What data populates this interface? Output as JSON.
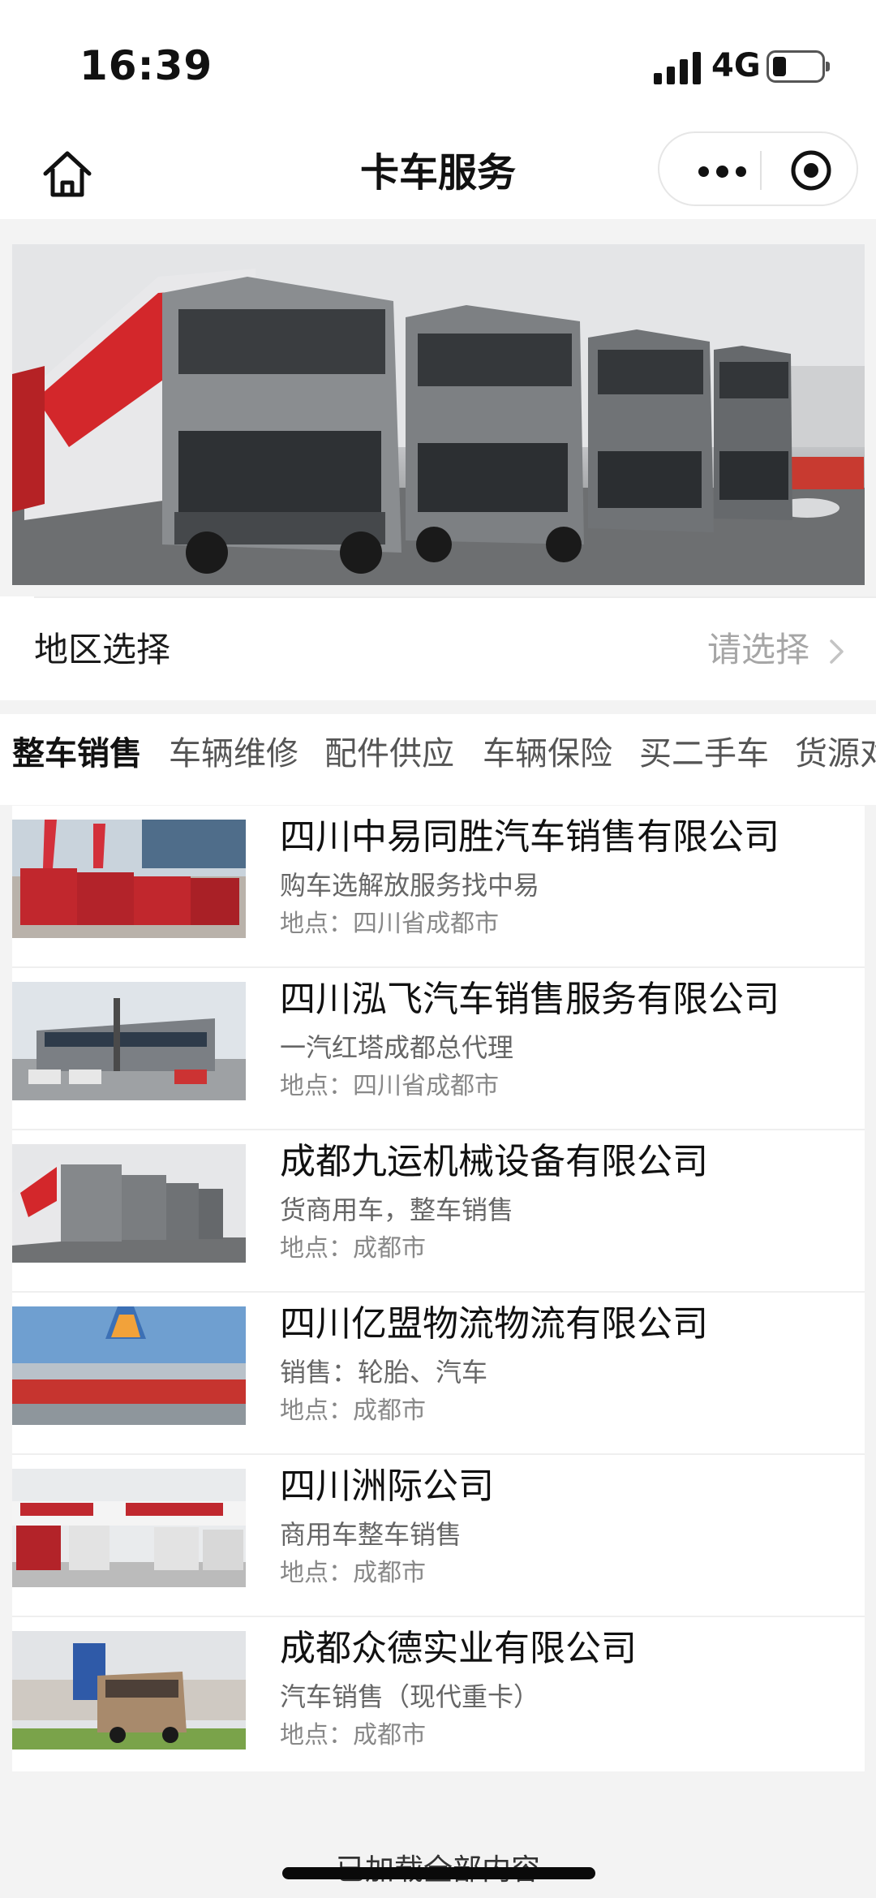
{
  "status_bar": {
    "time": "16:39",
    "network": "4G"
  },
  "nav": {
    "title": "卡车服务"
  },
  "region": {
    "label": "地区选择",
    "placeholder": "请选择"
  },
  "tabs": [
    {
      "label": "整车销售",
      "active": true
    },
    {
      "label": "车辆维修",
      "active": false
    },
    {
      "label": "配件供应",
      "active": false
    },
    {
      "label": "车辆保险",
      "active": false
    },
    {
      "label": "买二手车",
      "active": false
    },
    {
      "label": "货源对",
      "active": false
    }
  ],
  "companies": [
    {
      "name": "四川中易同胜汽车销售有限公司",
      "desc": "购车选解放服务找中易",
      "location": "地点：四川省成都市"
    },
    {
      "name": "四川泓飞汽车销售服务有限公司",
      "desc": "一汽红塔成都总代理",
      "location": "地点：四川省成都市"
    },
    {
      "name": "成都九运机械设备有限公司",
      "desc": "货商用车，整车销售",
      "location": "地点：成都市"
    },
    {
      "name": "四川亿盟物流物流有限公司",
      "desc": "销售：轮胎、汽车",
      "location": "地点：成都市"
    },
    {
      "name": "四川洲际公司",
      "desc": "商用车整车销售",
      "location": "地点：成都市"
    },
    {
      "name": "成都众德实业有限公司",
      "desc": "汽车销售（现代重卡）",
      "location": "地点：成都市"
    }
  ],
  "footer": {
    "load_all": "已加载全部内容"
  },
  "colors": {
    "accent": "#d8262c",
    "background": "#f3f3f3"
  }
}
